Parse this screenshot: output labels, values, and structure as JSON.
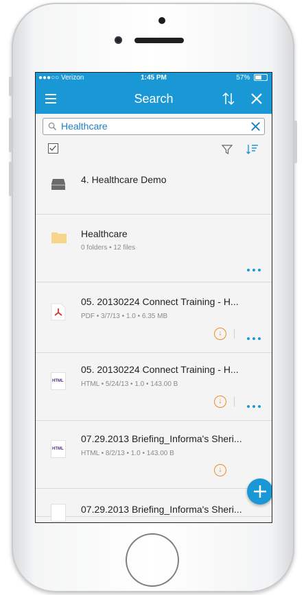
{
  "status": {
    "carrier": "●●●○○ Verizon",
    "time": "1:45 PM",
    "battery": "57%",
    "battery_level": 0.57
  },
  "nav": {
    "title": "Search"
  },
  "search": {
    "query": "Healthcare"
  },
  "results": [
    {
      "type": "workspace",
      "title": "4. Healthcare Demo"
    },
    {
      "type": "folder",
      "title": "Healthcare",
      "meta": "0 folders • 12 files"
    },
    {
      "type": "pdf",
      "title": "05. 20130224 Connect Training - H...",
      "meta": "PDF • 3/7/13 • 1.0 • 6.35 MB"
    },
    {
      "type": "html",
      "title": "05. 20130224 Connect Training - H...",
      "meta": "HTML • 5/24/13 • 1.0 • 143.00 B",
      "badge": "HTML"
    },
    {
      "type": "html",
      "title": "07.29.2013 Briefing_Informa's Sheri...",
      "meta": "HTML • 8/2/13 • 1.0 • 143.00 B",
      "badge": "HTML"
    },
    {
      "type": "html",
      "title": "07.29.2013 Briefing_Informa's Sheri..."
    }
  ],
  "colors": {
    "accent": "#1a98d5",
    "download": "#f08a24"
  }
}
